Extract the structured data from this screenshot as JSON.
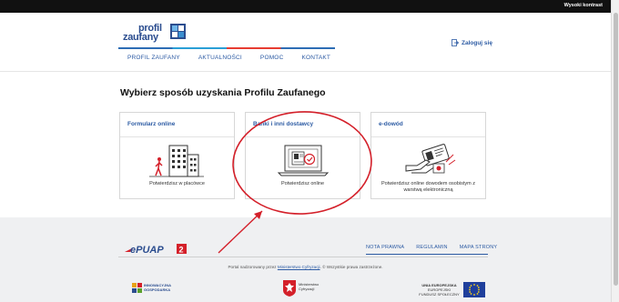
{
  "topbar": {
    "contrast_label": "Wysoki kontrast"
  },
  "header": {
    "logo_line1": "profil",
    "logo_line2": "zaufany",
    "login_label": "Zaloguj się"
  },
  "nav": {
    "items": [
      {
        "label": "PROFIL ZAUFANY"
      },
      {
        "label": "AKTUALNOŚCI"
      },
      {
        "label": "POMOC"
      },
      {
        "label": "KONTAKT"
      }
    ]
  },
  "main": {
    "title": "Wybierz sposób uzyskania Profilu Zaufanego",
    "cards": [
      {
        "title": "Formularz online",
        "desc": "Potwierdzisz w placówce",
        "icon": "building-icon"
      },
      {
        "title": "Banki i inni dostawcy",
        "desc": "Potwierdzisz online",
        "icon": "laptop-icon"
      },
      {
        "title": "e-dowód",
        "desc": "Potwierdzisz online dowodem osobistym z warstwą elektroniczną",
        "icon": "id-card-icon"
      }
    ]
  },
  "footer": {
    "epuap_label": "ePUAP",
    "epuap_version": "2",
    "links": [
      {
        "label": "NOTA PRAWNA"
      },
      {
        "label": "REGULAMIN"
      },
      {
        "label": "MAPA STRONY"
      }
    ],
    "copyright_prefix": "Portal nadzorowany przez",
    "copyright_link": "Ministerstwo Cyfryzacji",
    "copyright_suffix": ". © Wszystkie prawa zastrzeżone.",
    "logo_ig_line1": "INNOWACYJNA",
    "logo_ig_line2": "GOSPODARKA",
    "logo_mc_line1": "Ministerstwo",
    "logo_mc_line2": "Cyfryzacji",
    "logo_eu_line1": "UNIA EUROPEJSKA",
    "logo_eu_line2": "EUROPEJSKI",
    "logo_eu_line3": "FUNDUSZ SPOŁECZNY"
  },
  "colors": {
    "brand_blue": "#2b5aa3",
    "annotation_red": "#d4202a",
    "topbar": "#111111",
    "footer_bg": "#eff0f2"
  }
}
